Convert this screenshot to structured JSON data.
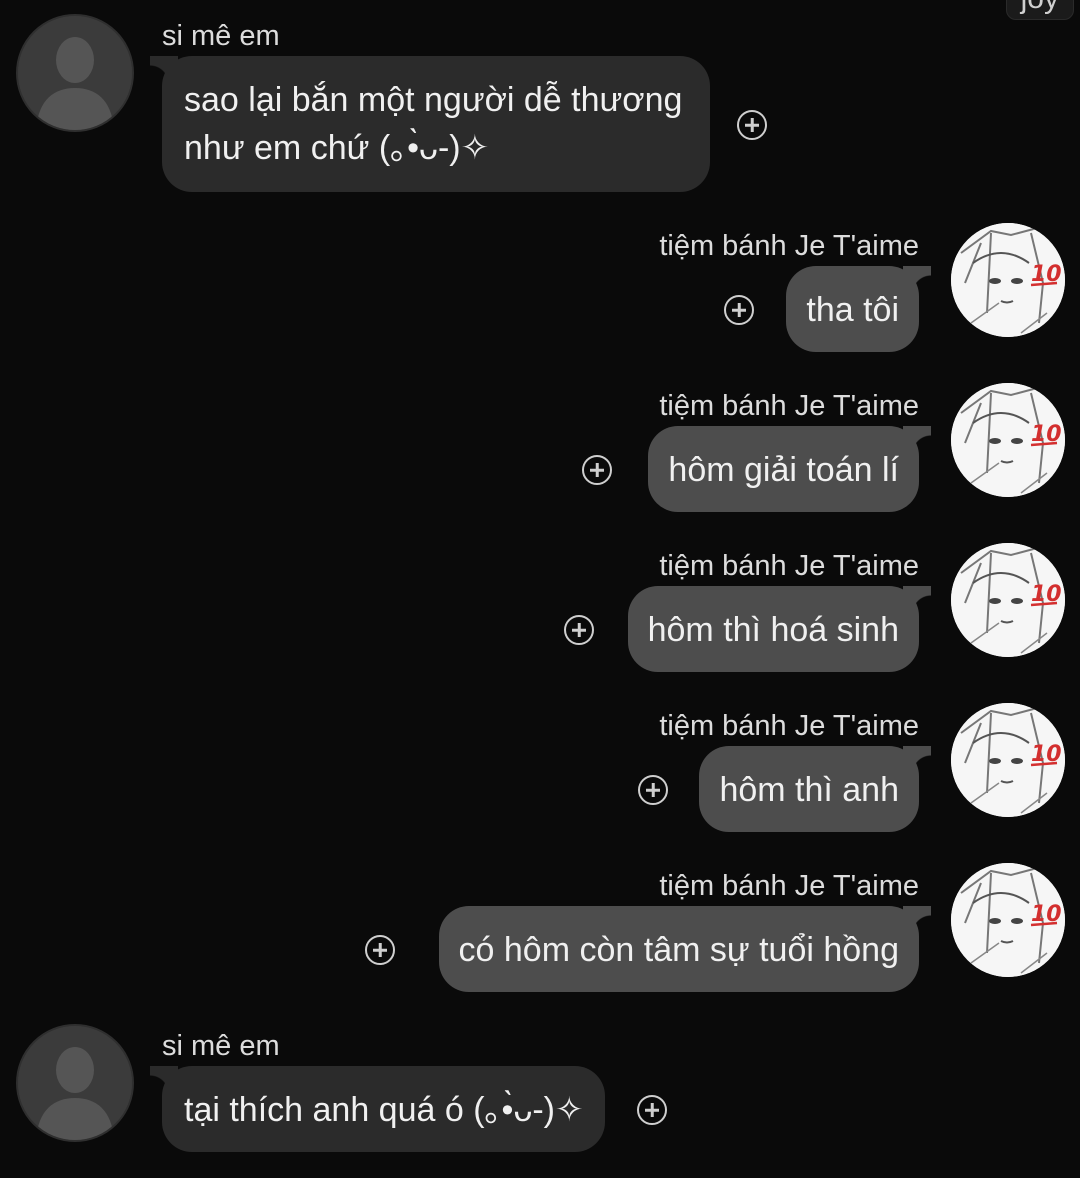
{
  "header": {
    "chip_text": "joy"
  },
  "messages": [
    {
      "direction": "incoming",
      "sender": "si mê em",
      "text_lines": [
        "sao lại bắn một người dễ thương",
        "như em chứ (｡•̀ᴗ-)✧"
      ]
    },
    {
      "direction": "outgoing",
      "sender": "tiệm bánh Je T'aime",
      "text": "tha tôi"
    },
    {
      "direction": "outgoing",
      "sender": "tiệm bánh Je T'aime",
      "text": "hôm giải toán lí"
    },
    {
      "direction": "outgoing",
      "sender": "tiệm bánh Je T'aime",
      "text": "hôm thì hoá sinh"
    },
    {
      "direction": "outgoing",
      "sender": "tiệm bánh Je T'aime",
      "text": "hôm thì anh"
    },
    {
      "direction": "outgoing",
      "sender": "tiệm bánh Je T'aime",
      "text": "có hôm còn tâm sự tuổi hồng"
    },
    {
      "direction": "incoming",
      "sender": "si mê em",
      "text": "tại thích anh quá ó (｡•̀ᴗ-)✧"
    }
  ],
  "icons": {
    "reaction": "add-reaction-icon",
    "incoming_avatar": "default-user-avatar-icon",
    "outgoing_avatar": "manga-girl-avatar-with-100-emoji"
  },
  "colors": {
    "background": "#0a0a0a",
    "incoming_bubble": "#2b2b2b",
    "outgoing_bubble": "#4d4d4d",
    "text": "#f0f0f0",
    "emoji_red": "#d32f2f"
  }
}
